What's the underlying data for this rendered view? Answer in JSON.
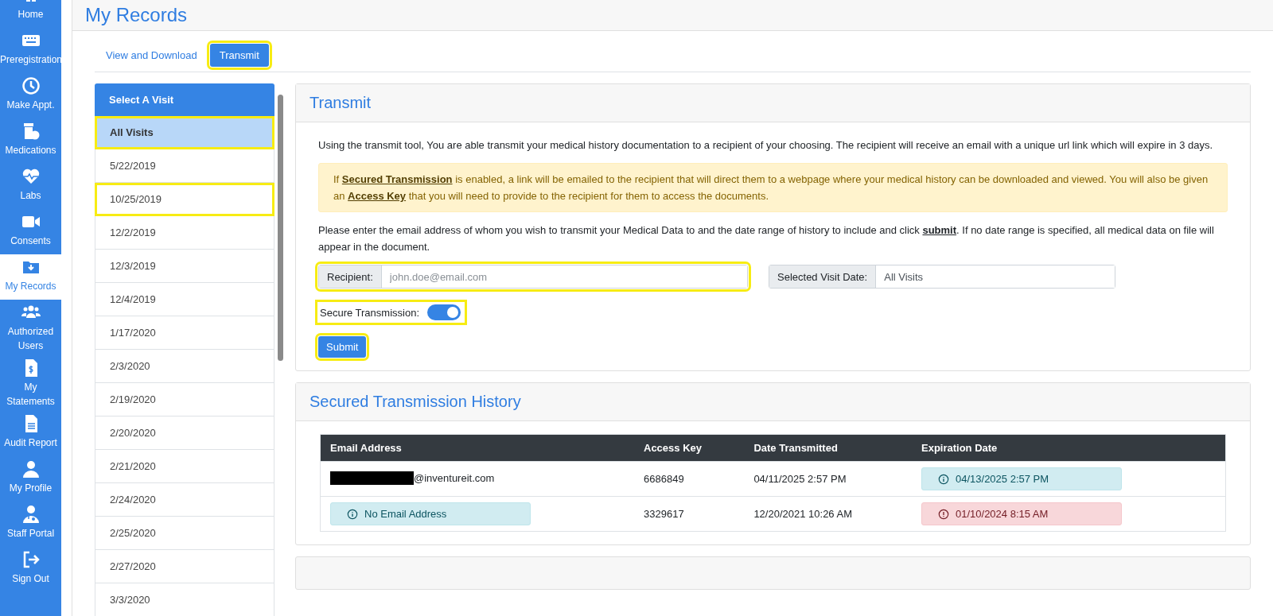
{
  "sidebar": {
    "items": [
      {
        "label": "Home",
        "selected": false
      },
      {
        "label": "Preregistration",
        "selected": false
      },
      {
        "label": "Make Appt.",
        "selected": false
      },
      {
        "label": "Medications",
        "selected": false
      },
      {
        "label": "Labs",
        "selected": false
      },
      {
        "label": "Consents",
        "selected": false
      },
      {
        "label": "My Records",
        "selected": true
      },
      {
        "label": "Authorized Users",
        "selected": false
      },
      {
        "label": "My Statements",
        "selected": false
      },
      {
        "label": "Audit Report",
        "selected": false
      },
      {
        "label": "My Profile",
        "selected": false
      },
      {
        "label": "Staff Portal",
        "selected": false
      },
      {
        "label": "Sign Out",
        "selected": false
      }
    ]
  },
  "page_title": "My Records",
  "tabs": [
    {
      "label": "View and Download",
      "selected": false,
      "highlighted": false
    },
    {
      "label": "Transmit",
      "selected": true,
      "highlighted": true
    }
  ],
  "visit_list": {
    "title": "Select A Visit",
    "items": [
      {
        "label": "All Visits",
        "selected": true,
        "highlighted": true
      },
      {
        "label": "5/22/2019",
        "selected": false,
        "highlighted": false
      },
      {
        "label": "10/25/2019",
        "selected": false,
        "highlighted": true
      },
      {
        "label": "12/2/2019",
        "selected": false,
        "highlighted": false
      },
      {
        "label": "12/3/2019",
        "selected": false,
        "highlighted": false
      },
      {
        "label": "12/4/2019",
        "selected": false,
        "highlighted": false
      },
      {
        "label": "1/17/2020",
        "selected": false,
        "highlighted": false
      },
      {
        "label": "2/3/2020",
        "selected": false,
        "highlighted": false
      },
      {
        "label": "2/19/2020",
        "selected": false,
        "highlighted": false
      },
      {
        "label": "2/20/2020",
        "selected": false,
        "highlighted": false
      },
      {
        "label": "2/21/2020",
        "selected": false,
        "highlighted": false
      },
      {
        "label": "2/24/2020",
        "selected": false,
        "highlighted": false
      },
      {
        "label": "2/25/2020",
        "selected": false,
        "highlighted": false
      },
      {
        "label": "2/27/2020",
        "selected": false,
        "highlighted": false
      },
      {
        "label": "3/3/2020",
        "selected": false,
        "highlighted": false
      }
    ]
  },
  "transmit": {
    "title": "Transmit",
    "intro": "Using the transmit tool, You are able transmit your medical history documentation to a recipient of your choosing. The recipient will receive an email with a unique url link which will expire in 3 days.",
    "notice": "If **Secured Transmission** is enabled, a link will be emailed to the recipient that will direct them to a webpage where your medical history can be downloaded and viewed. You will also be given an **Access Key** that you will need to provide to the recipient for them to access the documents.",
    "instructions": "Please enter the email address of whom you wish to transmit your Medical Data to and the date range of history to include and click **submit**. If no date range is specified, all medical data on file will appear in the document.",
    "recipient": {
      "label": "Recipient:",
      "placeholder": "john.doe@email.com",
      "highlighted": true
    },
    "visit_date": {
      "label": "Selected Visit Date:",
      "value": "All Visits"
    },
    "secure": {
      "label": "Secure Transmission:",
      "on": true,
      "highlighted": true
    },
    "submit": {
      "label": "Submit",
      "highlighted": true
    }
  },
  "history": {
    "title": "Secured Transmission History",
    "columns": [
      "Email Address",
      "Access Key",
      "Date Transmitted",
      "Expiration Date"
    ],
    "rows": [
      {
        "email": {
          "kind": "redacted",
          "text": "@inventureit.com"
        },
        "access_key": "6686849",
        "date_transmitted": "04/11/2025 2:57 PM",
        "expiration": {
          "kind": "info",
          "text": "04/13/2025 2:57 PM"
        }
      },
      {
        "email": {
          "kind": "info",
          "text": "No Email Address"
        },
        "access_key": "3329617",
        "date_transmitted": "12/20/2021 10:26 AM",
        "expiration": {
          "kind": "danger",
          "text": "01/10/2024 8:15 AM"
        }
      }
    ]
  }
}
